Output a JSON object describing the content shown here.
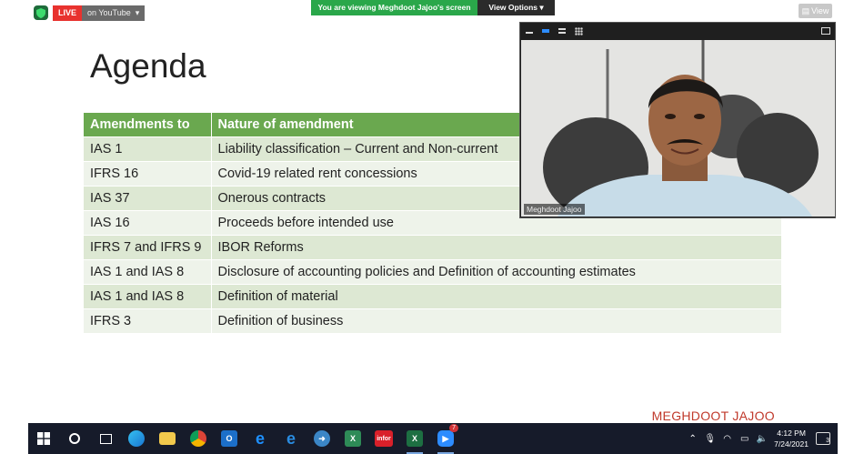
{
  "zoom_bar": {
    "live_label": "LIVE",
    "live_target": "on YouTube",
    "live_chevron": "▾",
    "viewing_text": "You are viewing Meghdoot Jajoo's screen",
    "view_options": "View Options ▾",
    "view_button": "View"
  },
  "slide": {
    "title": "Agenda",
    "table": {
      "headers": [
        "Amendments to",
        "Nature of amendment"
      ],
      "rows": [
        [
          "IAS 1",
          "Liability classification – Current and Non-current"
        ],
        [
          "IFRS 16",
          "Covid-19 related rent concessions"
        ],
        [
          "IAS 37",
          "Onerous contracts"
        ],
        [
          "IAS 16",
          "Proceeds before intended use"
        ],
        [
          "IFRS 7 and IFRS 9",
          "IBOR Reforms"
        ],
        [
          "IAS 1 and IAS 8",
          "Disclosure of accounting policies and Definition of accounting estimates"
        ],
        [
          "IAS 1 and IAS 8",
          "Definition of material"
        ],
        [
          "IFRS 3",
          "Definition of business"
        ]
      ]
    },
    "signature": "MEGHDOOT JAJOO"
  },
  "video": {
    "speaker_name": "Meghdoot Jajoo"
  },
  "taskbar": {
    "apps": [
      {
        "name": "start-icon",
        "color": "#ffffff"
      },
      {
        "name": "search-icon",
        "color": "#ffffff"
      },
      {
        "name": "task-view-icon",
        "color": "#ffffff"
      },
      {
        "name": "edge-icon",
        "color": "#2f9ae0"
      },
      {
        "name": "file-explorer-icon",
        "color": "#f2c94c"
      },
      {
        "name": "chrome-icon",
        "color": "#e8a33d"
      },
      {
        "name": "outlook-icon",
        "color": "#1c6fc9"
      },
      {
        "name": "internet-explorer-icon",
        "color": "#1e90ff"
      },
      {
        "name": "edge-legacy-icon",
        "color": "#2a8ce0"
      },
      {
        "name": "app-blue-icon",
        "color": "#3b86c6"
      },
      {
        "name": "excel-green-icon",
        "color": "#2e8b57"
      },
      {
        "name": "infor-icon",
        "color": "#d9202a"
      },
      {
        "name": "excel-icon",
        "color": "#1d6f42"
      },
      {
        "name": "zoom-icon",
        "color": "#2d8cff"
      }
    ],
    "infor_label": "infor",
    "zoom_badge": "7",
    "clock_time": "4:12 PM",
    "clock_date": "7/24/2021",
    "notification_count": "3"
  }
}
